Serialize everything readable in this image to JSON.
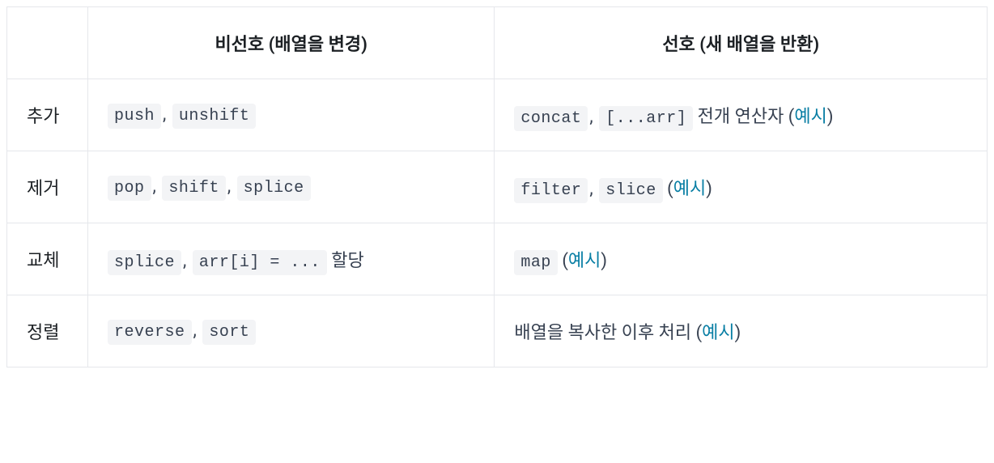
{
  "headers": {
    "col0": "",
    "col1": "비선호 (배열을 변경)",
    "col2": "선호 (새 배열을 반환)"
  },
  "rows": [
    {
      "label": "추가",
      "avoid": {
        "codes": [
          "push",
          "unshift"
        ],
        "suffix": ""
      },
      "prefer": {
        "codes": [
          "concat",
          "[...arr]"
        ],
        "suffix": " 전개 연산자 (",
        "link": "예시",
        "afterLink": ")"
      }
    },
    {
      "label": "제거",
      "avoid": {
        "codes": [
          "pop",
          "shift",
          "splice"
        ],
        "suffix": ""
      },
      "prefer": {
        "codes": [
          "filter",
          "slice"
        ],
        "suffix": " (",
        "link": "예시",
        "afterLink": ")"
      }
    },
    {
      "label": "교체",
      "avoid": {
        "codes": [
          "splice",
          "arr[i] = ..."
        ],
        "suffix": " 할당"
      },
      "prefer": {
        "codes": [
          "map"
        ],
        "suffix": " (",
        "link": "예시",
        "afterLink": ")"
      }
    },
    {
      "label": "정렬",
      "avoid": {
        "codes": [
          "reverse",
          "sort"
        ],
        "suffix": ""
      },
      "prefer": {
        "codes": [],
        "prefix": "배열을 복사한 이후 처리 (",
        "link": "예시",
        "afterLink": ")"
      }
    }
  ],
  "separator": ", "
}
